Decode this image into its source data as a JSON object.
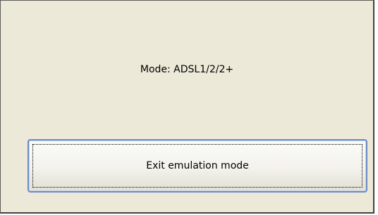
{
  "status": {
    "mode_text": "Mode: ADSL1/2/2+"
  },
  "actions": {
    "exit_emulation_label": "Exit emulation mode"
  },
  "colors": {
    "panel_background": "#ece9d8",
    "button_border": "#6c8ac6"
  }
}
